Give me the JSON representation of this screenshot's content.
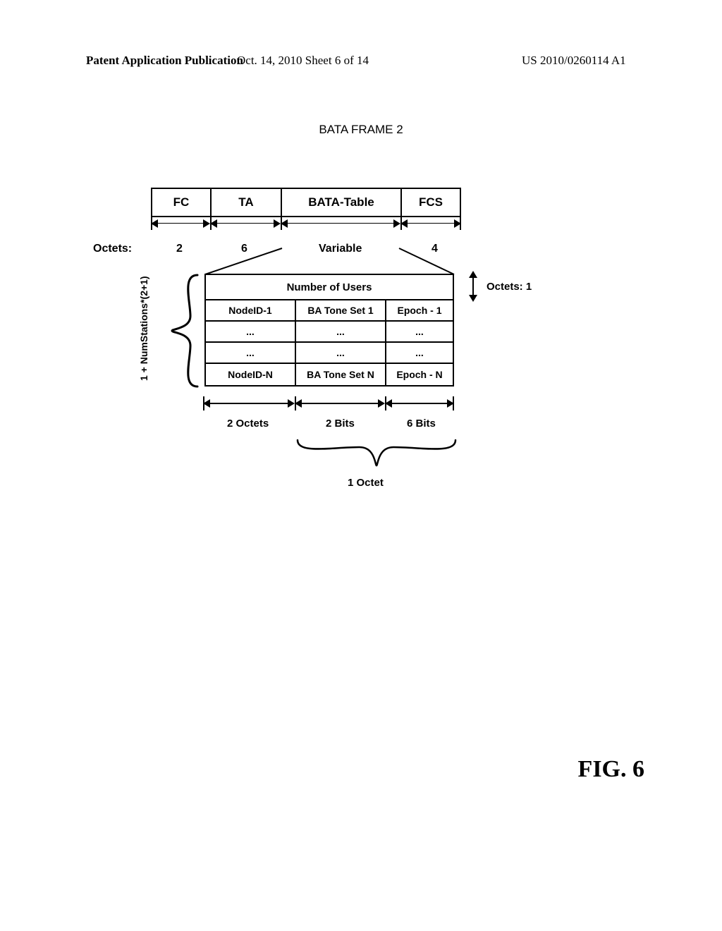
{
  "header": {
    "left": "Patent Application Publication",
    "mid": "Oct. 14, 2010  Sheet 6 of 14",
    "right": "US 2010/0260114 A1"
  },
  "title": "BATA FRAME 2",
  "frame": {
    "cells": [
      "FC",
      "TA",
      "BATA-Table",
      "FCS"
    ],
    "octets_label": "Octets:",
    "octets": [
      "2",
      "6",
      "Variable",
      "4"
    ]
  },
  "sub": {
    "side_label": "1 + NumStations*(2+1)",
    "header": "Number of Users",
    "rows": [
      [
        "NodeID-1",
        "BA Tone Set 1",
        "Epoch - 1"
      ],
      [
        "...",
        "...",
        "..."
      ],
      [
        "...",
        "...",
        "..."
      ],
      [
        "NodeID-N",
        "BA Tone Set N",
        "Epoch - N"
      ]
    ],
    "right_label": "Octets: 1",
    "dim_labels": [
      "2 Octets",
      "2 Bits",
      "6 Bits"
    ],
    "brace_label": "1 Octet"
  },
  "figure": "FIG. 6"
}
